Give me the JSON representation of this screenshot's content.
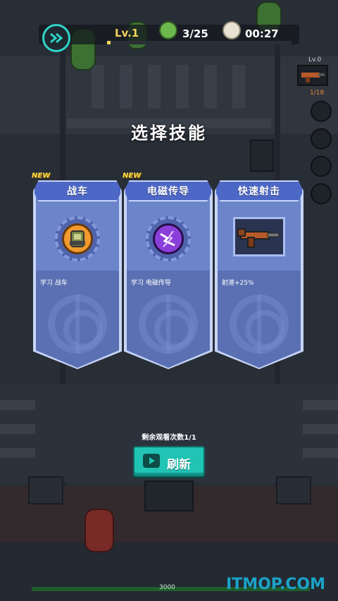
{
  "hud": {
    "level": "Lv.1",
    "xp_fraction": 0.02,
    "enemy_count": "3/25",
    "timer": "00:27"
  },
  "weapon": {
    "level": "Lv.0",
    "ammo": "1/18"
  },
  "title": "选择技能",
  "cards": [
    {
      "name": "战车",
      "badge": "NEW",
      "description": "学习 战车",
      "icon": "tank-icon",
      "icon_color": "#f29a2e"
    },
    {
      "name": "电磁传导",
      "badge": "NEW",
      "description": "学习 电磁传导",
      "icon": "lightning-icon",
      "icon_color": "#8b3fd9"
    },
    {
      "name": "快速射击",
      "badge": "",
      "description": "射速+25%",
      "icon": "rifle-icon",
      "icon_color": "#b85a2a"
    }
  ],
  "refresh": {
    "remaining_text": "剩余观看次数1/1",
    "button_label": "刷新"
  },
  "player": {
    "hp": "3000"
  },
  "watermark": "ITMOP.COM",
  "colors": {
    "accent_teal": "#20c3b4",
    "card_blue": "#6c84c9",
    "xp_yellow": "#f4d35e"
  }
}
